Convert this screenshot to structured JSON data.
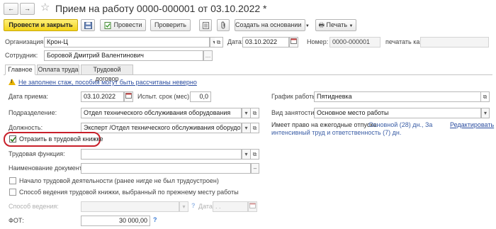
{
  "window": {
    "title": "Прием на работу 0000-000001 от 03.10.2022 *",
    "back_icon": "←",
    "forward_icon": "→",
    "star_icon": "☆"
  },
  "toolbar": {
    "post_close": "Провести и закрыть",
    "post": "Провести",
    "check": "Проверить",
    "create_based": "Создать на основании",
    "print": "Печать"
  },
  "header": {
    "org_label": "Организация:",
    "org_value": "Крон-Ц",
    "date_label": "Дата:",
    "date_value": "03.10.2022",
    "number_label": "Номер:",
    "number_value": "0000-000001",
    "print_as_label": "печатать как:",
    "print_as_value": "",
    "employee_label": "Сотрудник:",
    "employee_value": "Боровой Дмитрий Валентинович"
  },
  "tabs": [
    {
      "label": "Главное"
    },
    {
      "label": "Оплата труда"
    },
    {
      "label": "Трудовой договор"
    }
  ],
  "warning": {
    "text": "Не заполнен стаж, пособия могут быть рассчитаны неверно"
  },
  "form": {
    "hire_date_label": "Дата приема:",
    "hire_date_value": "03.10.2022",
    "probation_label": "Испыт. срок (мес):",
    "probation_value": "0,0",
    "schedule_label": "График работы:",
    "schedule_value": "Пятидневка",
    "department_label": "Подразделение:",
    "department_value": "Отдел технического обслуживания оборудования",
    "employment_label": "Вид занятости:",
    "employment_value": "Основное место работы",
    "position_label": "Должность:",
    "position_value": "Эксперт /Отдел технического обслуживания оборудования/",
    "vacation_label": "Имеет право на ежегодные отпуска:",
    "vacation_value": "Основной (28) дн., За",
    "vacation_value2": "интенсивный труд и ответственность (7) дн.",
    "edit_link": "Редактировать",
    "workbook_checkbox": "Отразить в трудовой книжке",
    "labor_function_label": "Трудовая функция:",
    "doc_name_label": "Наименование документа:",
    "start_activity_checkbox": "Начало трудовой деятельности (ранее нигде не был трудоустроен)",
    "method_checkbox": "Способ ведения трудовой книжки, выбранный по прежнему месту работы",
    "method_label": "Способ ведения:",
    "date2_label": "Дата:",
    "date2_value": ". .",
    "fot_label": "ФОТ:",
    "fot_value": "30 000,00"
  }
}
